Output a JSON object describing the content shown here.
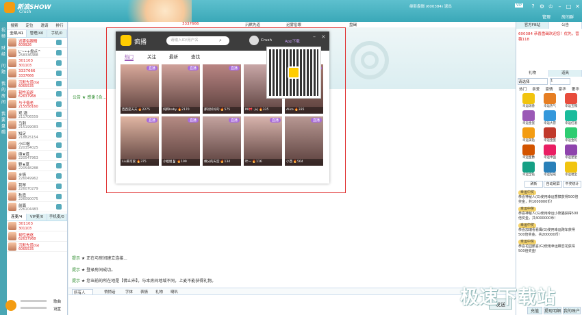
{
  "window": {
    "title": "新浪SHOW",
    "subtitle": "Crush",
    "user_info": "缘影盘碣 (600384) 退出",
    "badge": "VIP"
  },
  "title_links": [
    "管理",
    "房间群"
  ],
  "left_vertical": [
    "视频",
    "财经",
    "问题",
    "我的房间",
    "我要盘碣"
  ],
  "left_panel": {
    "buttons": [
      "搜索",
      "定位",
      "邀请",
      "排行"
    ],
    "tabs": [
      "全部/41",
      "管理/40",
      "手机/0"
    ],
    "users": [
      {
        "name": "迟雾俗眼睛",
        "id": "609926",
        "red": true
      },
      {
        "name": "L'~•+盘点^",
        "id": "258336488",
        "red": false
      },
      {
        "name": "301103",
        "id": "301103",
        "red": true
      },
      {
        "name": "3337666",
        "id": "3337666",
        "red": true
      },
      {
        "name": "沉默先道(G)",
        "id": "6065535",
        "red": true
      },
      {
        "name": "韧性追逐",
        "id": "62637968",
        "red": true
      },
      {
        "name": "与子偕老",
        "id": "215558160",
        "red": true
      },
      {
        "name": "观 酒",
        "id": "211706559",
        "red": false
      },
      {
        "name": "马刺",
        "id": "215199083",
        "red": false
      },
      {
        "name": "知足",
        "id": "218825154",
        "red": false
      },
      {
        "name": "小红帽",
        "id": "220354025",
        "red": false
      },
      {
        "name": "麻★道",
        "id": "220547963",
        "red": false
      },
      {
        "name": "野★草",
        "id": "220548288",
        "red": false
      },
      {
        "name": "乡情",
        "id": "226049962",
        "red": false
      },
      {
        "name": "我琴",
        "id": "226070279",
        "red": false
      },
      {
        "name": "秋霞",
        "id": "226090075",
        "red": false
      },
      {
        "name": "前面",
        "id": "226104483",
        "red": false
      }
    ],
    "tabs2": [
      "连麦/4",
      "VIP麦/0",
      "手机麦/0"
    ],
    "users2": [
      {
        "name": "301103",
        "id": "301103"
      },
      {
        "name": "韧性追逐",
        "id": "62637968"
      },
      {
        "name": "沉默先道(G)",
        "id": "6065535"
      }
    ],
    "bottom_labels": [
      "歌曲",
      "设置"
    ]
  },
  "mic_bar": [
    "3337666",
    "沉默先道",
    "迟雾俗眼",
    "盘碣"
  ],
  "popup": {
    "app_name": "疯播",
    "search_placeholder": "请输入ID/用户名",
    "user": "Crush",
    "download": "App下载",
    "tabs": [
      "热门",
      "关注",
      "最新",
      "查找"
    ],
    "tiles": [
      {
        "badge": "直播",
        "cap": "西西是天天 🔥2275"
      },
      {
        "badge": "直播",
        "cap": "纯粹baby 🔥2170"
      },
      {
        "badge": "直播",
        "cap": "那就好好的 🔥575"
      },
      {
        "badge": "直播",
        "cap": "Mi🎀 .jvj 🔥335"
      },
      {
        "badge": "直播",
        "cap": "Alice 🔥335"
      },
      {
        "badge": "直播",
        "cap": "Liu黄可爱 🔥375"
      },
      {
        "badge": "直播",
        "cap": "小姐姐🐰 🔥199"
      },
      {
        "badge": "直播",
        "cap": "缘分的天空 🔥134"
      },
      {
        "badge": "直播",
        "cap": "叶一 🔥116"
      },
      {
        "badge": "直播",
        "cap": "小西 🔥564"
      }
    ]
  },
  "announce": "公告 ★ 感谢 [合...",
  "chat": [
    {
      "tag": "提示",
      "text": "正在与房间建立连接..."
    },
    {
      "tag": "提示",
      "text": "登录房间成功。"
    },
    {
      "tag": "提示",
      "text": "您当前的所在地是【佛山市】，与本房间地域不同，上麦不能获得礼物。"
    }
  ],
  "toolbar": [
    "所有人",
    "悄悄话",
    "字体",
    "表情",
    "礼物",
    "喇叭"
  ],
  "send_label": "发送",
  "right_panel": {
    "tabs": [
      "官方FB站",
      "公告"
    ],
    "notice": "600384 恭喜盘碣欢迎您！优先，营薇118",
    "tabs2": [
      "礼物",
      "道具"
    ],
    "select_placeholder": "请选择",
    "qty": "1",
    "cats": [
      "热门",
      "亲爱",
      "恩情",
      "豪华",
      "奢华"
    ],
    "gifts": [
      "幸运瑞香",
      "幸运热气",
      "幸运玉镯",
      "幸运金蛋",
      "幸运大冒",
      "幸运红酒",
      "幸运美钻",
      "幸运金蛋",
      "幸运金蛇",
      "幸运金爵",
      "幸运中国",
      "幸运星星",
      "幸运全钻",
      "幸运钻戒",
      "幸运福宝"
    ],
    "buttons": [
      "刷新",
      "自动刷屏",
      "中奖统计"
    ],
    "messages": [
      {
        "tag": "幸运中奖",
        "text": "恭喜神秘人(G)使用幸运香槟获得500倍奖金，共1000000币！"
      },
      {
        "tag": "幸运中奖",
        "text": "恭喜神秘人(G)使用幸运小熊猫获得500倍奖金，共4000000币！"
      },
      {
        "tag": "幸运中奖",
        "text": "恭喜加瑞看看鹰(G)使用幸运跑车获得500倍奖金，共200000币！"
      },
      {
        "tag": "幸运中奖",
        "text": "恭喜花园鹏喜(G)使用幸运蝶恋花获得500倍奖金！"
      }
    ],
    "bottom": [
      "充值",
      "提现明细",
      "我的账户"
    ]
  },
  "watermark": "极速下载站",
  "colors": {
    "title": "#3aa8b8",
    "accent": "#9b59b6",
    "alert": "#e03030"
  }
}
